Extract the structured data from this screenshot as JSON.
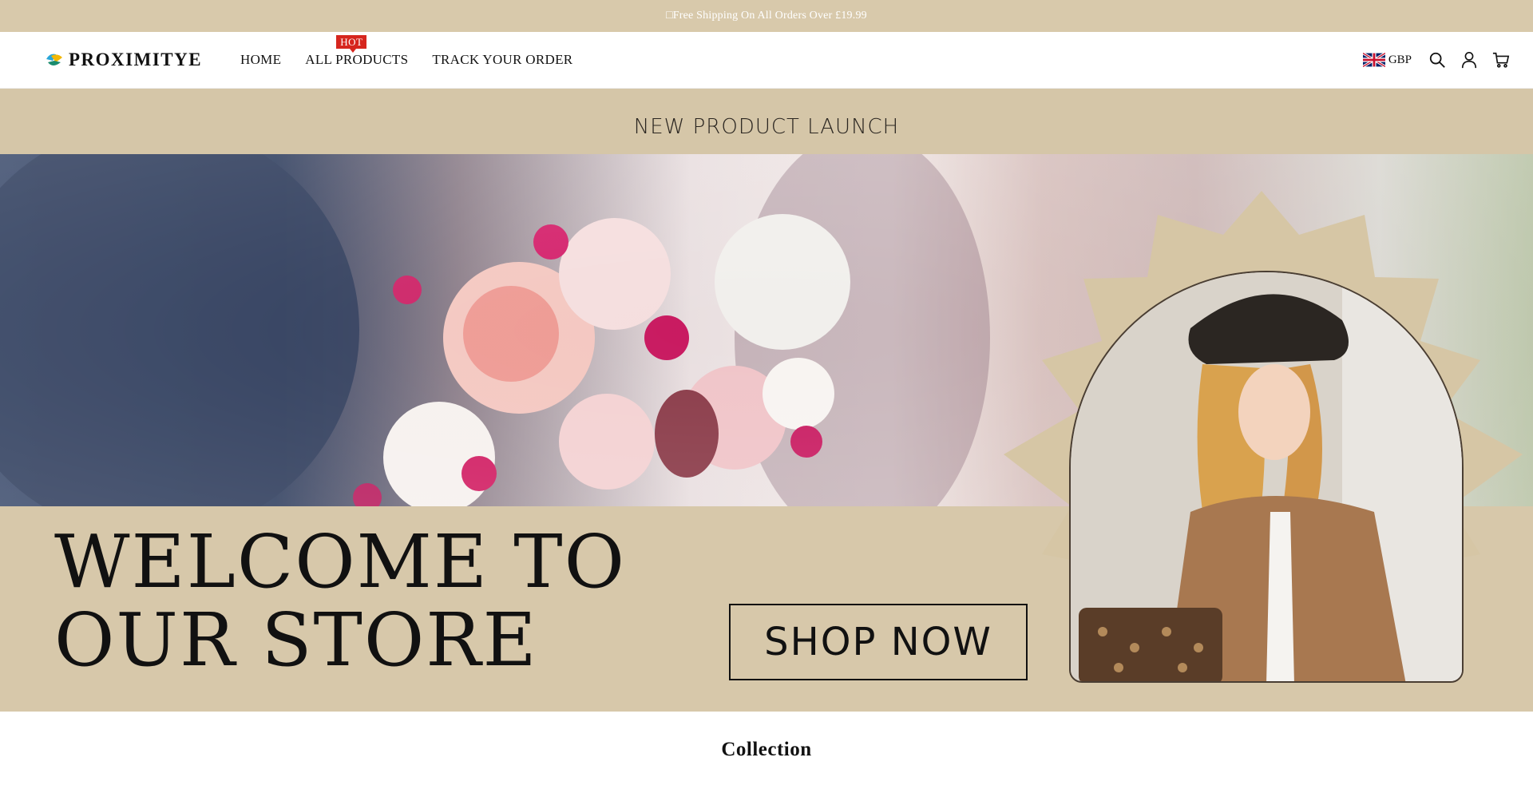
{
  "announcement": {
    "text": "□Free Shipping On All Orders Over £19.99"
  },
  "header": {
    "logo_text": "PROXIMITYE",
    "nav": [
      {
        "label": "HOME"
      },
      {
        "label": "ALL PRODUCTS",
        "badge": "HOT"
      },
      {
        "label": "TRACK YOUR ORDER"
      }
    ],
    "currency": {
      "code": "GBP",
      "flag": "uk-flag-icon"
    },
    "icons": [
      "search-icon",
      "account-icon",
      "cart-icon"
    ]
  },
  "hero": {
    "tagline": "NEW PRODUCT LAUNCH",
    "headline_line1": "WELCOME TO",
    "headline_line2": "OUR STORE",
    "cta_label": "SHOP NOW"
  },
  "collection": {
    "title": "Collection"
  },
  "colors": {
    "announcement_bg": "#d8c9ab",
    "hero_bg": "#d7c8aa",
    "badge_red": "#d6261e",
    "text_dark": "#111111"
  }
}
